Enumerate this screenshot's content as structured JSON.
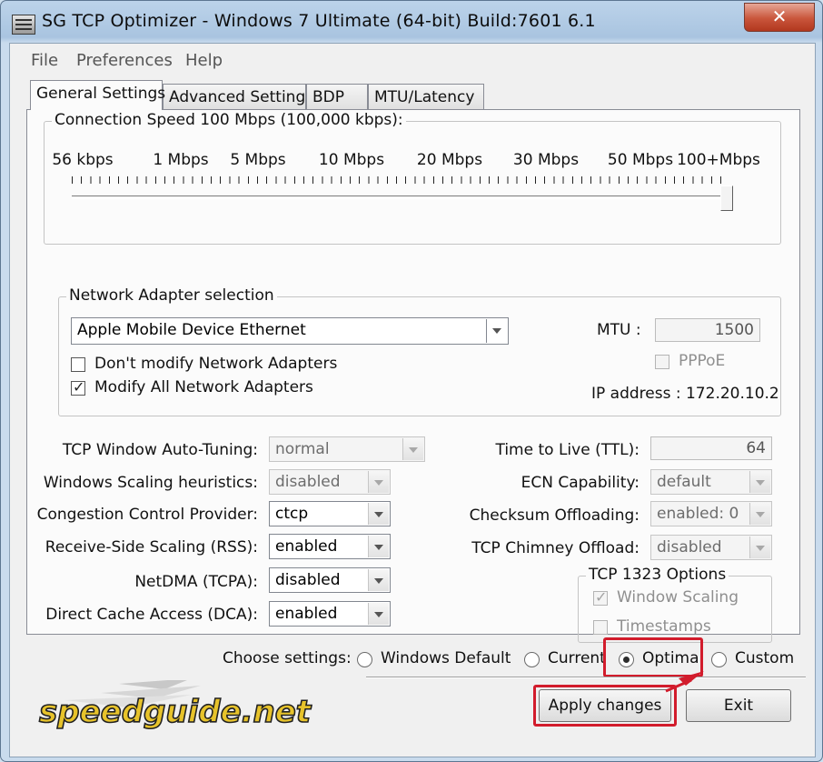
{
  "window": {
    "title": "SG TCP Optimizer - Windows 7 Ultimate (64-bit) Build:7601 6.1",
    "close_glyph": "✕",
    "icon": "app-icon"
  },
  "menu": {
    "items": [
      "File",
      "Preferences",
      "Help"
    ]
  },
  "tabs": [
    {
      "label": "General Settings",
      "active": true
    },
    {
      "label": "Advanced Settings",
      "active": false
    },
    {
      "label": "BDP",
      "active": false
    },
    {
      "label": "MTU/Latency",
      "active": false
    }
  ],
  "speed": {
    "title": "Connection Speed  100 Mbps (100,000 kbps):",
    "ticks": [
      "56 kbps",
      "1 Mbps",
      "5 Mbps",
      "10 Mbps",
      "20 Mbps",
      "30 Mbps",
      "50 Mbps",
      "100+Mbps"
    ],
    "slider_value": "100+Mbps",
    "slider_fraction": 1.0
  },
  "adapter": {
    "title": "Network Adapter selection",
    "selected": "Apple Mobile Device Ethernet",
    "dont_modify_label": "Don't modify Network Adapters",
    "dont_modify_checked": false,
    "modify_all_label": "Modify All Network Adapters",
    "modify_all_checked": true,
    "mtu_label": "MTU :",
    "mtu_value": "1500",
    "pppoe_label": "PPPoE",
    "pppoe_checked": false,
    "ip_label": "IP address : 172.20.10.2"
  },
  "left_settings": [
    {
      "label": "TCP Window Auto-Tuning:",
      "value": "normal"
    },
    {
      "label": "Windows Scaling heuristics:",
      "value": "disabled"
    },
    {
      "label": "Congestion Control Provider:",
      "value": "ctcp"
    },
    {
      "label": "Receive-Side Scaling (RSS):",
      "value": "enabled"
    },
    {
      "label": "NetDMA (TCPA):",
      "value": "disabled"
    },
    {
      "label": "Direct Cache Access (DCA):",
      "value": "enabled"
    }
  ],
  "right_settings": {
    "ttl_label": "Time to Live (TTL):",
    "ttl_value": "64",
    "ecn_label": "ECN Capability:",
    "ecn_value": "default",
    "checksum_label": "Checksum Offloading:",
    "checksum_value": "enabled: 0",
    "chimney_label": "TCP Chimney Offload:",
    "chimney_value": "disabled"
  },
  "tcp1323": {
    "title": "TCP 1323 Options",
    "window_scaling_label": "Window Scaling",
    "window_scaling_checked": true,
    "timestamps_label": "Timestamps",
    "timestamps_checked": false
  },
  "choose": {
    "label": "Choose settings:",
    "options": [
      "Windows Default",
      "Current",
      "Optimal",
      "Custom"
    ],
    "selected": "Optimal"
  },
  "buttons": {
    "apply": "Apply changes",
    "exit": "Exit"
  },
  "logo": {
    "text": "speedguide.net"
  },
  "colors": {
    "highlight": "#d21c2c",
    "title_bar": "#bcd3ea",
    "logo_fill": "#e7c32b"
  }
}
